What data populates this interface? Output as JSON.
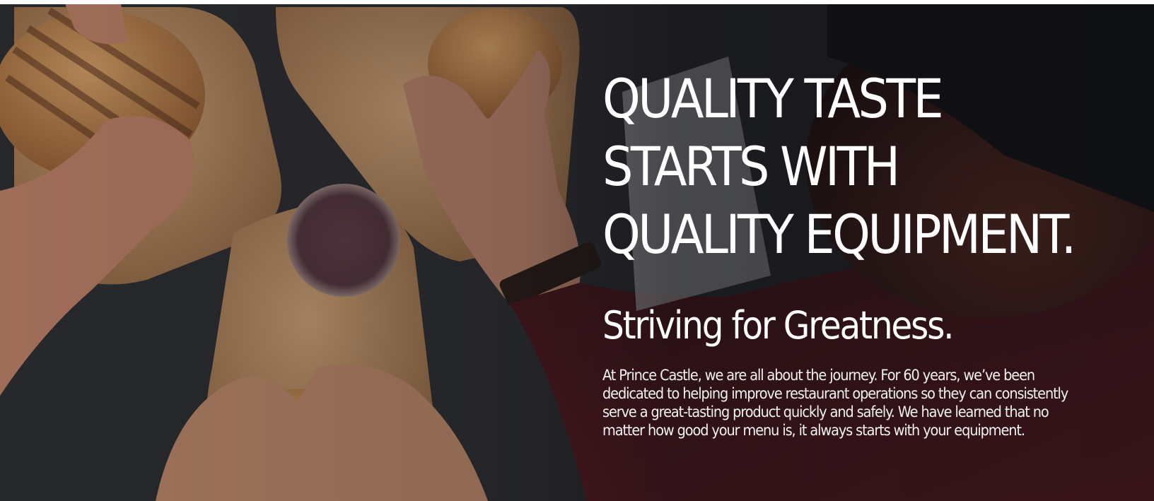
{
  "hero": {
    "headline_lines": [
      "QUALITY TASTE",
      "STARTS WITH",
      "QUALITY EQUIPMENT."
    ],
    "subheading": "Striving for Greatness.",
    "body_lines": [
      "At Prince Castle, we are all about the journey. For 60 years, we’ve been",
      "dedicated to helping improve restaurant operations so they can consistently",
      "serve a great-tasting product quickly and safely. We have learned that no",
      "matter how good your menu is, it always starts with your equipment."
    ]
  },
  "colors": {
    "text": "#ffffff",
    "table": "#3a3a3c",
    "wood": "#c99a6d",
    "bun": "#d8a064",
    "skin": "#c98b6f",
    "shirt": "#6d1f25"
  }
}
